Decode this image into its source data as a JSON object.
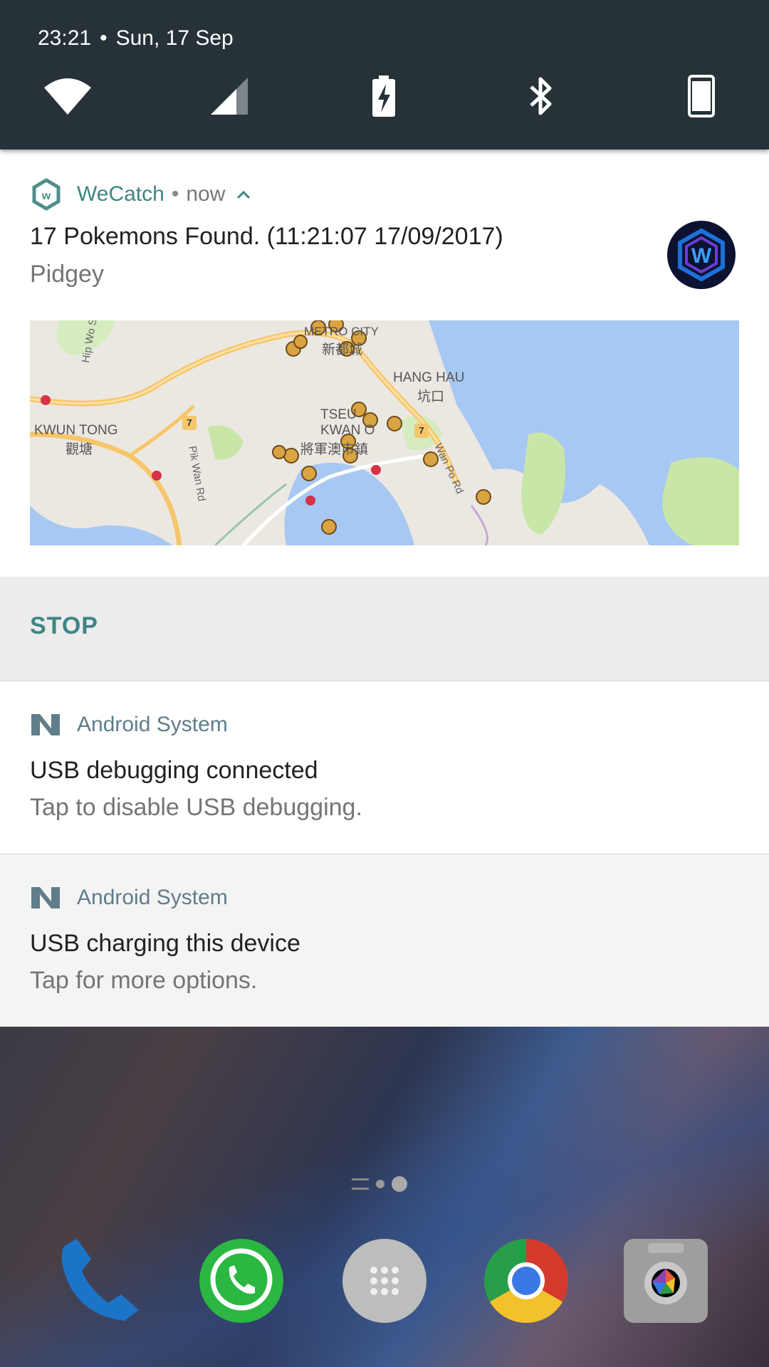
{
  "status_bar": {
    "time": "23:21",
    "separator": "•",
    "date": "Sun, 17 Sep"
  },
  "quick_settings": [
    {
      "name": "wifi-icon"
    },
    {
      "name": "cellular-signal-icon"
    },
    {
      "name": "battery-charging-icon"
    },
    {
      "name": "bluetooth-icon"
    },
    {
      "name": "rotation-lock-icon"
    }
  ],
  "wecatch_notification": {
    "app_name": "WeCatch",
    "separator": "•",
    "time": "now",
    "title": "17 Pokemons Found. (11:21:07 17/09/2017)",
    "text": "Pidgey",
    "avatar_letter": "W",
    "map_labels": {
      "metro_city": "METRO CITY",
      "metro_city_cn": "新都城",
      "hang_hau": "HANG HAU",
      "hang_hau_cn": "坑口",
      "kwun_tong": "KWUN TONG",
      "kwun_tong_cn": "觀塘",
      "tseung_kwan_o_1": "TSEU",
      "tseung_kwan_o_2": "KWAN O",
      "tseung_kwan_o_cn": "將軍澳市鎮",
      "hip_wo_st": "Hip Wo St",
      "pik_wan_rd": "Pik Wan Rd",
      "wan_po_rd": "Wan Po Rd",
      "route_7a": "7",
      "route_7b": "7"
    },
    "action_stop": "STOP",
    "accent_color": "#3f8585"
  },
  "debug_notification": {
    "app_name": "Android System",
    "title": "USB debugging connected",
    "text": "Tap to disable USB debugging."
  },
  "charge_notification": {
    "app_name": "Android System",
    "title": "USB charging this device",
    "text": "Tap for more options."
  },
  "home_screen": {
    "dock": [
      {
        "name": "phone-icon"
      },
      {
        "name": "whatsapp-icon"
      },
      {
        "name": "app-drawer-icon"
      },
      {
        "name": "chrome-icon"
      },
      {
        "name": "camera-icon"
      }
    ]
  }
}
